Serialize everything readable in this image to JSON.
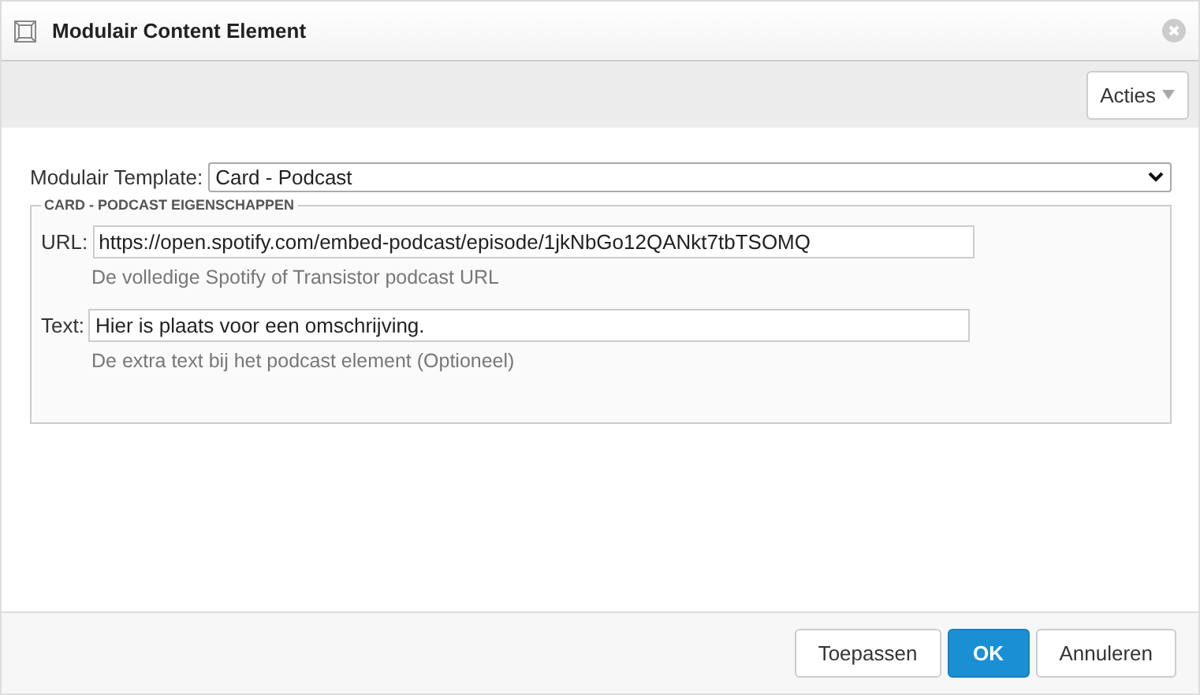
{
  "window": {
    "title": "Modulair Content Element"
  },
  "toolbar": {
    "actions_button": "Acties"
  },
  "template": {
    "label": "Modulair Template:",
    "value": "Card - Podcast"
  },
  "fieldset": {
    "legend": "CARD - PODCAST EIGENSCHAPPEN",
    "fields": [
      {
        "label": "URL:",
        "value": "https://open.spotify.com/embed-podcast/episode/1jkNbGo12QANkt7tbTSOMQ",
        "help": "De volledige Spotify of Transistor podcast URL"
      },
      {
        "label": "Text:",
        "value": "Hier is plaats voor een omschrijving.",
        "help": "De extra text bij het podcast element (Optioneel)"
      }
    ]
  },
  "buttons": [
    {
      "label": "Toepassen",
      "kind": "default"
    },
    {
      "label": "OK",
      "kind": "primary"
    },
    {
      "label": "Annuleren",
      "kind": "default"
    }
  ]
}
